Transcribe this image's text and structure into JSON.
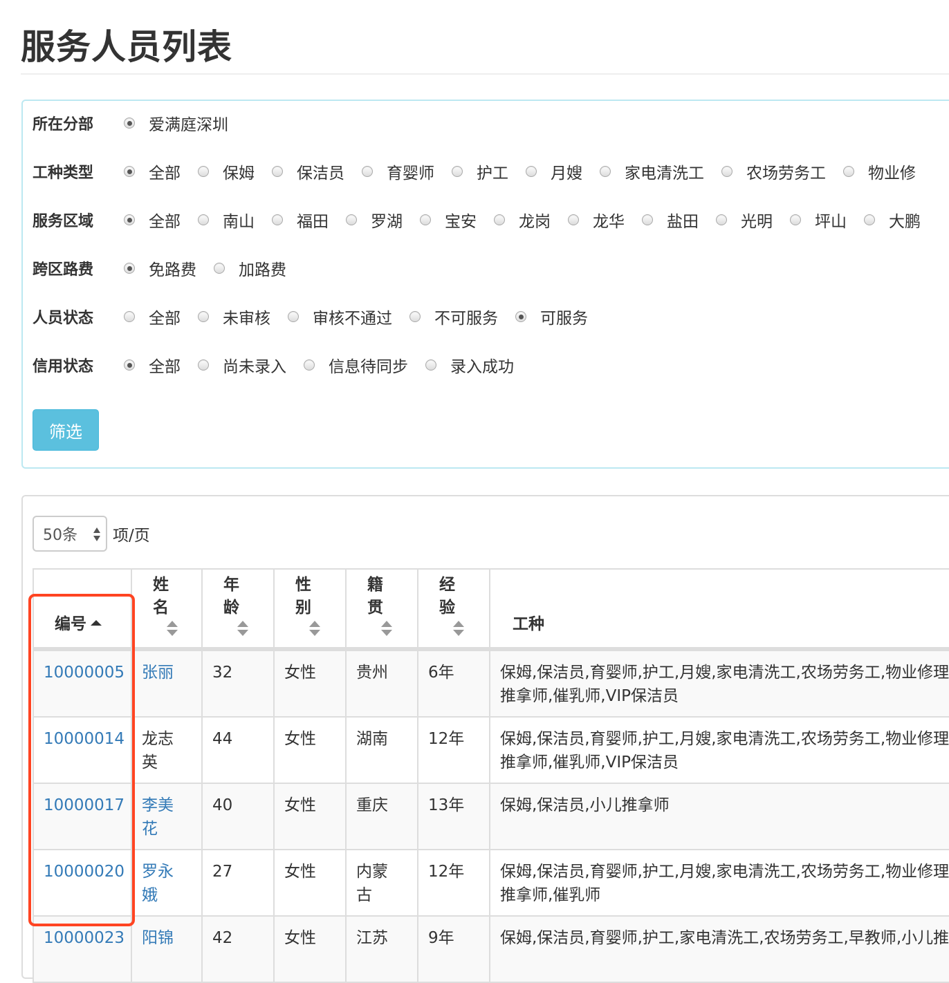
{
  "header": {
    "title": "服务人员列表"
  },
  "filters": {
    "rows": [
      {
        "label": "所在分部",
        "options": [
          {
            "label": "爱满庭深圳",
            "checked": true
          }
        ]
      },
      {
        "label": "工种类型",
        "options": [
          {
            "label": "全部",
            "checked": true
          },
          {
            "label": "保姆",
            "checked": false
          },
          {
            "label": "保洁员",
            "checked": false
          },
          {
            "label": "育婴师",
            "checked": false
          },
          {
            "label": "护工",
            "checked": false
          },
          {
            "label": "月嫂",
            "checked": false
          },
          {
            "label": "家电清洗工",
            "checked": false
          },
          {
            "label": "农场劳务工",
            "checked": false
          },
          {
            "label": "物业修",
            "checked": false
          }
        ]
      },
      {
        "label": "服务区域",
        "options": [
          {
            "label": "全部",
            "checked": true
          },
          {
            "label": "南山",
            "checked": false
          },
          {
            "label": "福田",
            "checked": false
          },
          {
            "label": "罗湖",
            "checked": false
          },
          {
            "label": "宝安",
            "checked": false
          },
          {
            "label": "龙岗",
            "checked": false
          },
          {
            "label": "龙华",
            "checked": false
          },
          {
            "label": "盐田",
            "checked": false
          },
          {
            "label": "光明",
            "checked": false
          },
          {
            "label": "坪山",
            "checked": false
          },
          {
            "label": "大鹏",
            "checked": false
          }
        ]
      },
      {
        "label": "跨区路费",
        "options": [
          {
            "label": "免路费",
            "checked": true
          },
          {
            "label": "加路费",
            "checked": false
          }
        ]
      },
      {
        "label": "人员状态",
        "options": [
          {
            "label": "全部",
            "checked": false
          },
          {
            "label": "未审核",
            "checked": false
          },
          {
            "label": "审核不通过",
            "checked": false
          },
          {
            "label": "不可服务",
            "checked": false
          },
          {
            "label": "可服务",
            "checked": true
          }
        ]
      },
      {
        "label": "信用状态",
        "options": [
          {
            "label": "全部",
            "checked": true
          },
          {
            "label": "尚未录入",
            "checked": false
          },
          {
            "label": "信息待同步",
            "checked": false
          },
          {
            "label": "录入成功",
            "checked": false
          }
        ]
      }
    ],
    "submit_label": "筛选"
  },
  "list": {
    "page_size": {
      "value": "50条",
      "suffix": "项/页"
    },
    "columns": [
      {
        "key": "id",
        "label": "编号",
        "sort": "asc"
      },
      {
        "key": "name",
        "label": "姓名",
        "sort": "both"
      },
      {
        "key": "age",
        "label": "年龄",
        "sort": "both"
      },
      {
        "key": "gender",
        "label": "性别",
        "sort": "both"
      },
      {
        "key": "origin",
        "label": "籍贯",
        "sort": "both"
      },
      {
        "key": "experience",
        "label": "经验",
        "sort": "both"
      },
      {
        "key": "job_types",
        "label": "工种",
        "sort": "none"
      }
    ],
    "rows": [
      {
        "id": "10000005",
        "name": "张丽",
        "name_link": true,
        "age": "32",
        "gender": "女性",
        "origin": "贵州",
        "experience": "6年",
        "job_types": "保姆,保洁员,育婴师,护工,月嫂,家电清洗工,农场劳务工,物业修理工,早教师,小儿推拿师,催乳师,VIP保洁员"
      },
      {
        "id": "10000014",
        "name": "龙志英",
        "name_link": false,
        "age": "44",
        "gender": "女性",
        "origin": "湖南",
        "experience": "12年",
        "job_types": "保姆,保洁员,育婴师,护工,月嫂,家电清洗工,农场劳务工,物业修理工,早教师,小儿推拿师,催乳师,VIP保洁员"
      },
      {
        "id": "10000017",
        "name": "李美花",
        "name_link": true,
        "age": "40",
        "gender": "女性",
        "origin": "重庆",
        "experience": "13年",
        "job_types": "保姆,保洁员,小儿推拿师"
      },
      {
        "id": "10000020",
        "name": "罗永娥",
        "name_link": true,
        "age": "27",
        "gender": "女性",
        "origin": "内蒙古",
        "experience": "12年",
        "job_types": "保姆,保洁员,育婴师,护工,月嫂,家电清洗工,农场劳务工,物业修理工,早教师,小儿推拿师,催乳师"
      },
      {
        "id": "10000023",
        "name": "阳锦",
        "name_link": true,
        "age": "42",
        "gender": "女性",
        "origin": "江苏",
        "experience": "9年",
        "job_types": "保姆,保洁员,育婴师,护工,家电清洗工,农场劳务工,早教师,小儿推拿师"
      }
    ]
  },
  "colors": {
    "info_button": "#5bc0de",
    "panel_info_border": "#bce8f1",
    "link": "#337ab7",
    "highlight_annotation": "#ff4422"
  }
}
